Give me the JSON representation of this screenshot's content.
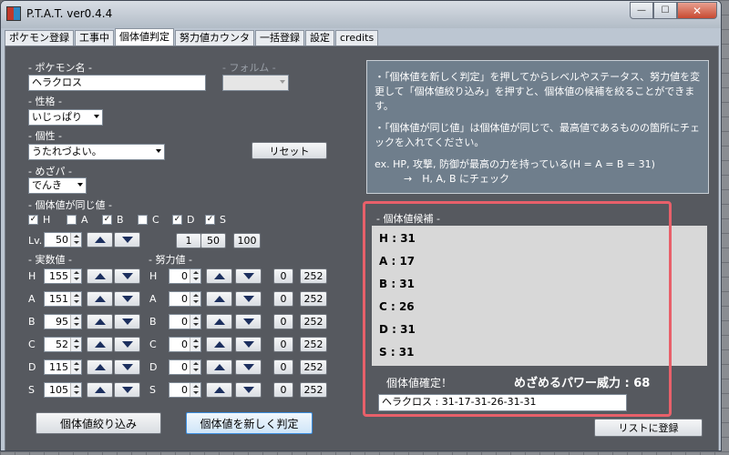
{
  "window": {
    "title": "P.T.A.T. ver0.4.4"
  },
  "tabs": [
    "ポケモン登録",
    "工事中",
    "個体値判定",
    "努力値カウンタ",
    "一括登録",
    "設定",
    "credits"
  ],
  "form": {
    "pokemon_label": "- ポケモン名 -",
    "pokemon_value": "ヘラクロス",
    "form_label": "- フォルム -",
    "form_value": "",
    "nature_label": "- 性格 -",
    "nature_value": "いじっぱり",
    "ability_label": "- 個性 -",
    "ability_value": "うたれづよい。",
    "reset_label": "リセット",
    "hp_label": "- めざパ -",
    "hp_value": "でんき",
    "same_label": "- 個体値が同じ値 -",
    "checks": [
      {
        "k": "H",
        "c": true
      },
      {
        "k": "A",
        "c": false
      },
      {
        "k": "B",
        "c": true
      },
      {
        "k": "C",
        "c": false
      },
      {
        "k": "D",
        "c": true
      },
      {
        "k": "S",
        "c": true
      }
    ],
    "lv_label": "Lv.",
    "lv_value": "50",
    "lv_presets": [
      "1",
      "50",
      "100"
    ],
    "stats_label": "- 実数値 -",
    "ev_label": "- 努力値 -",
    "stats": [
      {
        "k": "H",
        "v": "155",
        "ev": "0"
      },
      {
        "k": "A",
        "v": "151",
        "ev": "0"
      },
      {
        "k": "B",
        "v": "95",
        "ev": "0"
      },
      {
        "k": "C",
        "v": "52",
        "ev": "0"
      },
      {
        "k": "D",
        "v": "115",
        "ev": "0"
      },
      {
        "k": "S",
        "v": "105",
        "ev": "0"
      }
    ],
    "ev_zero": "0",
    "ev_max": "252",
    "narrow_label": "個体値絞り込み",
    "judge_label": "個体値を新しく判定"
  },
  "info": {
    "p1": "・「個体値を新しく判定」を押してからレベルやステータス、努力値を変更して「個体値絞り込み」を押すと、個体値の候補を絞ることができます。",
    "p2": "・「個体値が同じ値」は個体値が同じで、最高値であるものの箇所にチェックを入れてください。",
    "ex1": "ex. HP, 攻撃, 防御が最高の力を持っている(H = A = B = 31)",
    "ex2": "→　H, A, B にチェック"
  },
  "result": {
    "cand_label": "- 個体値候補 -",
    "rows": [
      "H : 31",
      "A : 17",
      "B : 31",
      "C : 26",
      "D : 31",
      "S : 31"
    ],
    "confirmed_label": "個体値確定！",
    "hidden_power": "めざめるパワー威力 : 68",
    "summary": "ヘラクロス : 31-17-31-26-31-31",
    "register_label": "リストに登録"
  }
}
